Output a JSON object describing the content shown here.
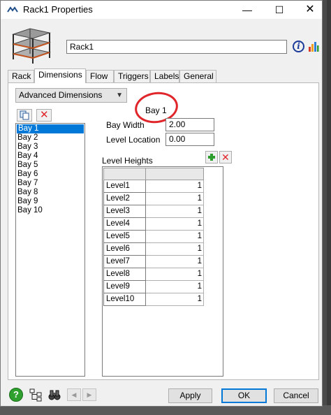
{
  "window": {
    "title": "Rack1  Properties",
    "controls": [
      "—",
      "☐",
      "✕"
    ]
  },
  "object_name": "Rack1",
  "tabs": [
    {
      "label": "Rack"
    },
    {
      "label": "Dimensions"
    },
    {
      "label": "Flow"
    },
    {
      "label": "Triggers"
    },
    {
      "label": "Labels"
    },
    {
      "label": "General"
    }
  ],
  "active_tab": "Dimensions",
  "dimensions": {
    "mode_select": "Advanced Dimensions",
    "bay_title": "Bay 1",
    "bays": [
      "Bay 1",
      "Bay 2",
      "Bay 3",
      "Bay 4",
      "Bay 5",
      "Bay 6",
      "Bay 7",
      "Bay 8",
      "Bay 9",
      "Bay 10"
    ],
    "selected_bay": "Bay 1",
    "bay_width_label": "Bay Width",
    "bay_width_value": "2.00",
    "level_location_label": "Level Location",
    "level_location_value": "0.00",
    "level_heights_label": "Level Heights",
    "levels": [
      {
        "label": "Level1",
        "value": "1"
      },
      {
        "label": "Level2",
        "value": "1"
      },
      {
        "label": "Level3",
        "value": "1"
      },
      {
        "label": "Level4",
        "value": "1"
      },
      {
        "label": "Level5",
        "value": "1"
      },
      {
        "label": "Level6",
        "value": "1"
      },
      {
        "label": "Level7",
        "value": "1"
      },
      {
        "label": "Level8",
        "value": "1"
      },
      {
        "label": "Level9",
        "value": "1"
      },
      {
        "label": "Level10",
        "value": "1"
      }
    ]
  },
  "footer": {
    "help_glyph": "?",
    "prev_glyph": "◀",
    "next_glyph": "▶",
    "apply_label": "Apply",
    "ok_label": "OK",
    "cancel_label": "Cancel"
  },
  "colors": {
    "selection": "#0078d7",
    "annotation_circle": "#e0262b",
    "delete_x": "#e0262b",
    "add_plus": "#2e9d2e"
  },
  "icons": [
    "rack-model-icon",
    "copy-icon",
    "delete-icon",
    "add-icon",
    "remove-icon",
    "info-icon",
    "chart-icon",
    "help-icon",
    "tree-icon",
    "binoculars-icon",
    "prev-arrow-icon",
    "next-arrow-icon"
  ]
}
